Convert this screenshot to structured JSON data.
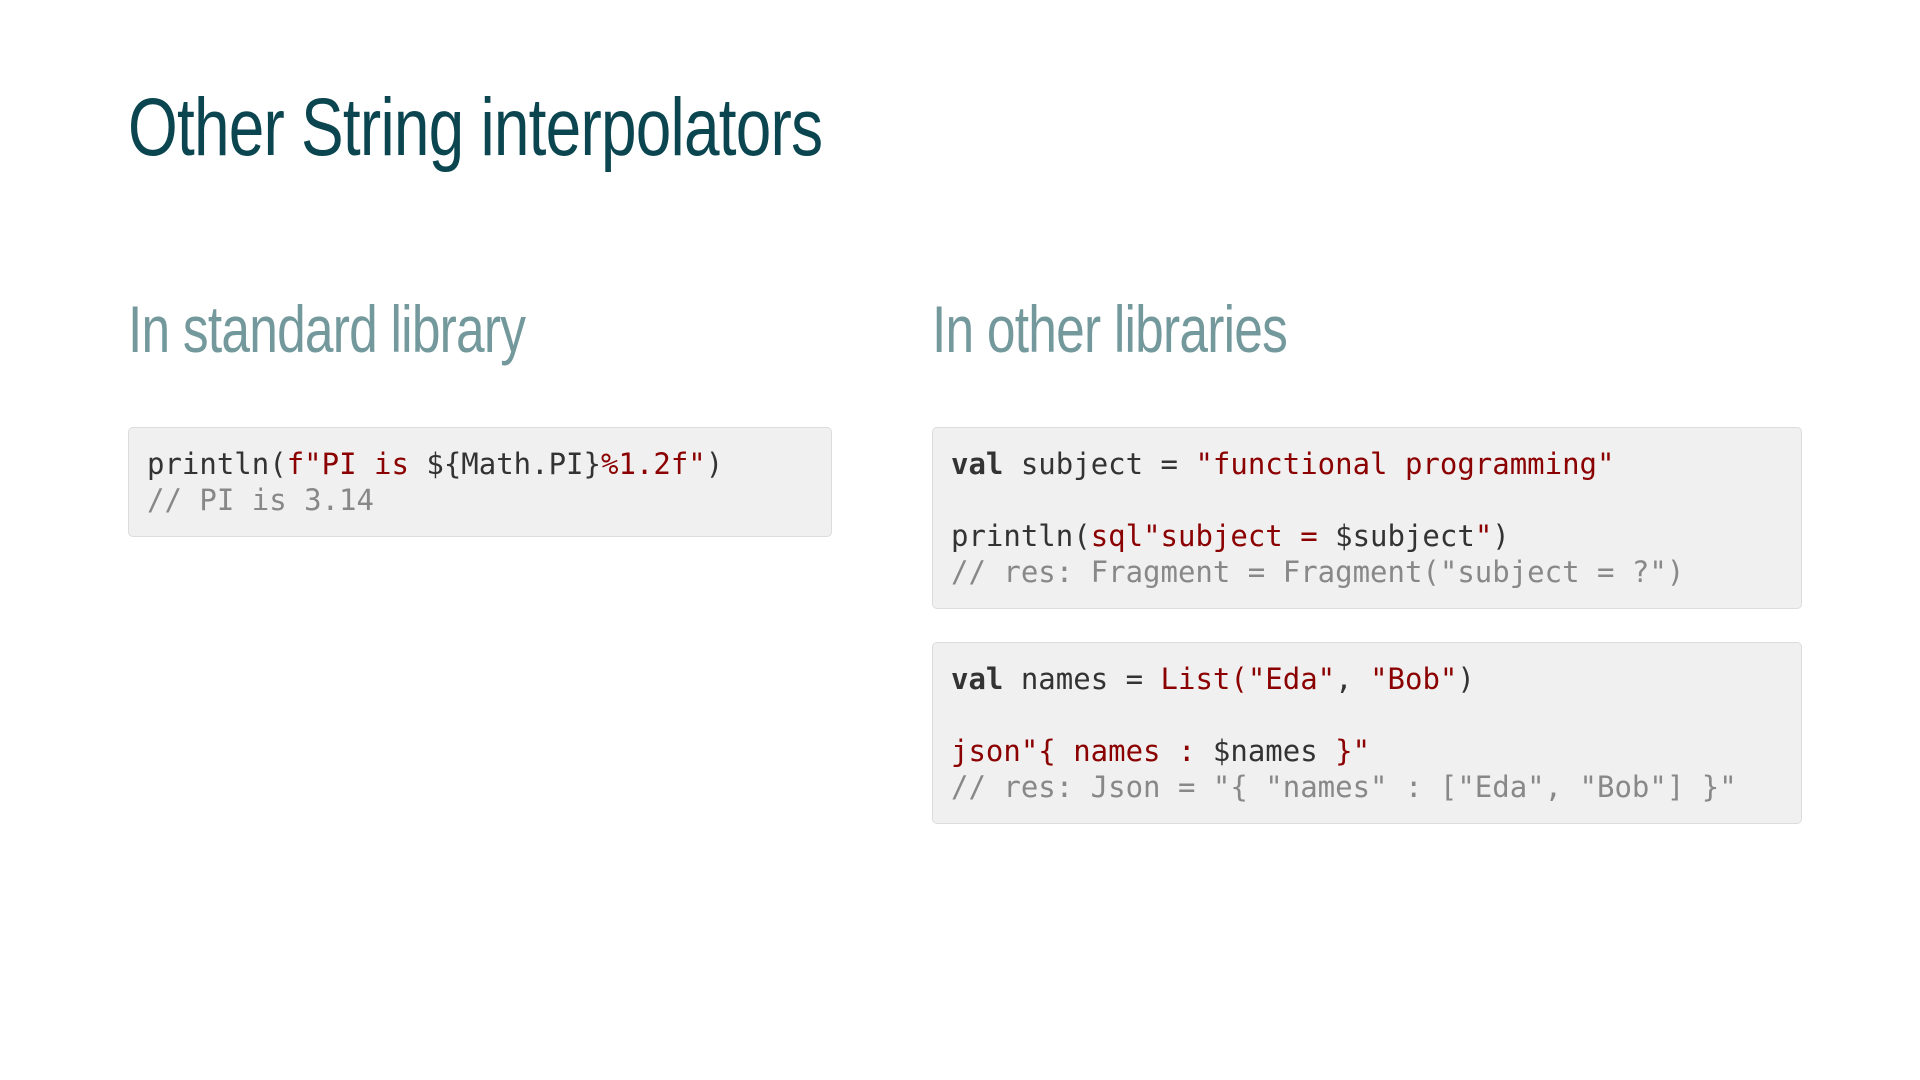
{
  "slide": {
    "title": "Other String interpolators",
    "left_heading": "In standard library",
    "right_heading": "In other libraries"
  },
  "code_blocks": {
    "standard": {
      "l1_a": "println(",
      "l1_b": "f\"PI is ",
      "l1_c": "${Math.PI}",
      "l1_d": "%1.2f\"",
      "l1_e": ")",
      "l2": "// PI is 3.14"
    },
    "sql": {
      "l1_kw": "val",
      "l1_a": " subject = ",
      "l1_str": "\"functional programming\"",
      "l3_a": "println(",
      "l3_b": "sql\"subject = ",
      "l3_c": "$subject",
      "l3_d": "\"",
      "l3_e": ")",
      "l4": "// res: Fragment = Fragment(\"subject = ?\")"
    },
    "json": {
      "l1_kw": "val",
      "l1_a": " names = ",
      "l1_b": "List(",
      "l1_c": "\"Eda\"",
      "l1_d": ", ",
      "l1_e": "\"Bob\"",
      "l1_f": ")",
      "l3_a": "json\"{ names : ",
      "l3_b": "$names",
      "l3_c": " }\"",
      "l4": "// res: Json = \"{ \"names\" : [\"Eda\", \"Bob\"] }\""
    }
  },
  "colors": {
    "title": "#0b4650",
    "heading": "#74999c",
    "code_background": "#f0f0f0",
    "string": "#8b0000",
    "comment": "#888888"
  }
}
